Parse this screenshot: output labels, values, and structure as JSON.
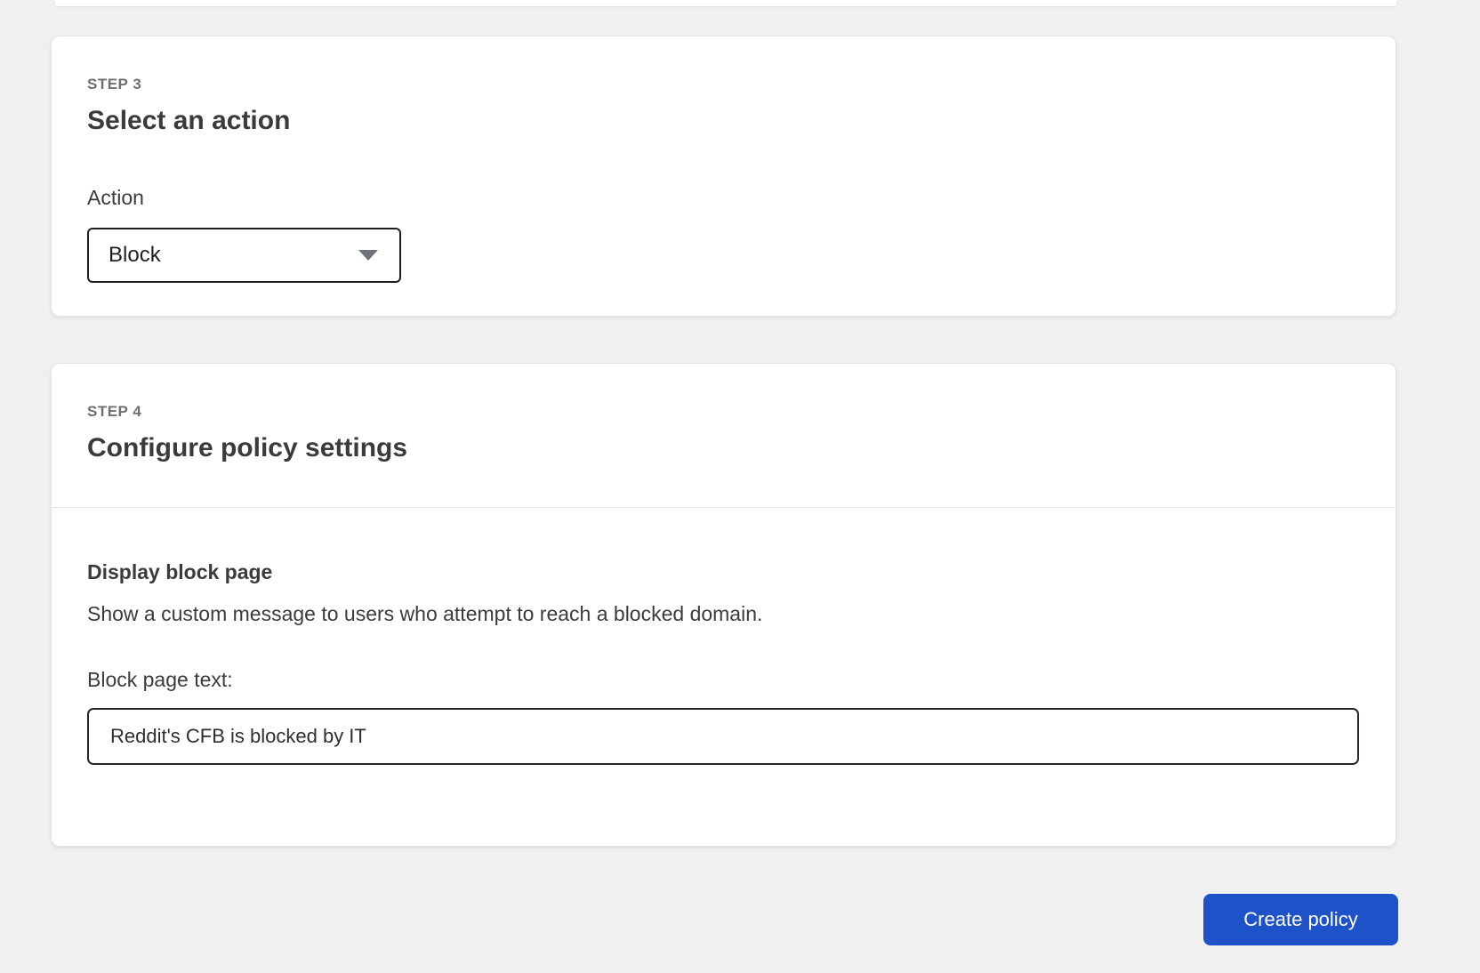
{
  "cards": {
    "step3": {
      "step_label": "STEP 3",
      "title": "Select an action",
      "field_label": "Action",
      "select_value": "Block"
    },
    "step4": {
      "step_label": "STEP 4",
      "title": "Configure policy settings",
      "section_heading": "Display block page",
      "section_description": "Show a custom message to users who attempt to reach a blocked domain.",
      "field_label": "Block page text:",
      "field_value": "Reddit's CFB is blocked by IT"
    }
  },
  "actions": {
    "create_button_label": "Create policy"
  },
  "icons": {
    "select_caret": "chevron-down"
  },
  "colors": {
    "page_background": "#f0f0f0",
    "card_background": "#ffffff",
    "primary_button_blue": "#1e52c8",
    "step_label_gray": "#6f6f6f",
    "heading_dark": "#3b3b3b",
    "control_border_dark": "#1c1f24",
    "card_border": "#e4e4e4",
    "divider": "#e2e2e2"
  }
}
